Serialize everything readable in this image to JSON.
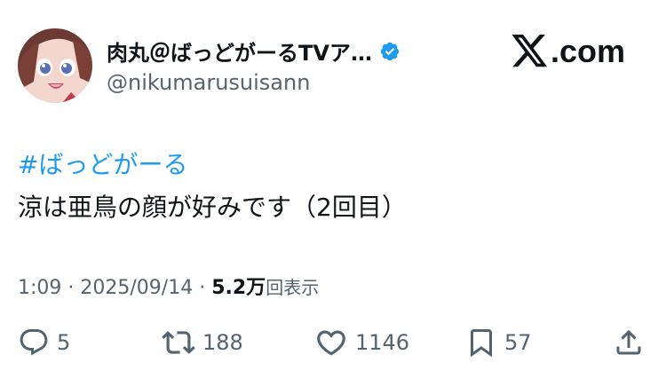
{
  "author": {
    "display_name": "肉丸＠ばっどがーるTVア…",
    "handle": "@nikumarusuisann",
    "verified": true
  },
  "brand": {
    "label": ".com",
    "logo_icon": "x-logo-icon"
  },
  "tweet": {
    "hashtag": "#ばっどがーる",
    "text": "涼は亜鳥の顔が好みです（2回目）"
  },
  "meta": {
    "time": "1:09",
    "separator": "·",
    "date": "2025/09/14",
    "views_count": "5.2万",
    "views_label": "回表示"
  },
  "actions": {
    "replies": "5",
    "reposts": "188",
    "likes": "1146",
    "bookmarks": "57"
  },
  "colors": {
    "link": "#1d9bf0",
    "text": "#0f1419",
    "muted": "#536471",
    "verified": "#1d9bf0"
  }
}
